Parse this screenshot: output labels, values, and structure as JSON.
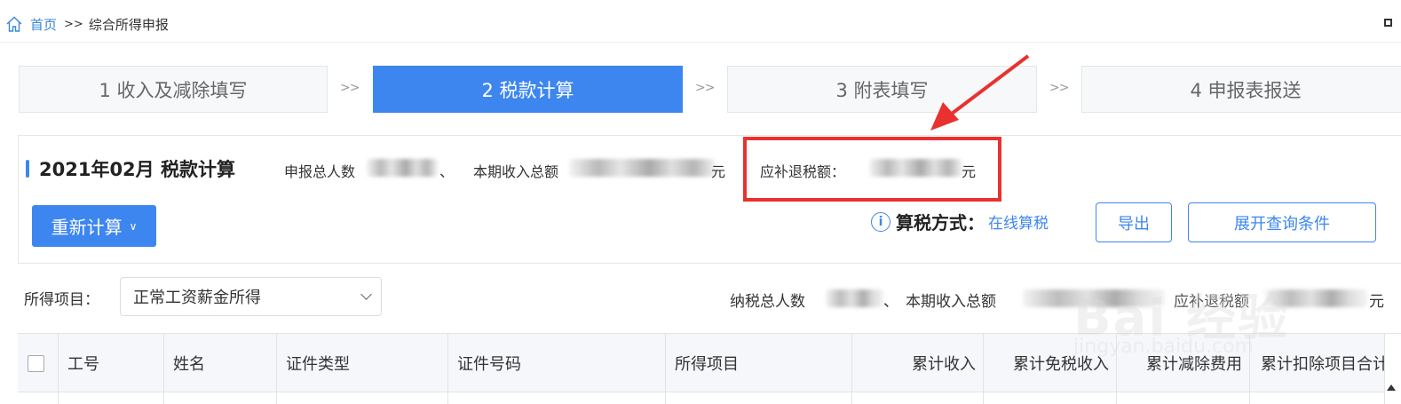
{
  "breadcrumb": {
    "home_icon": "home-icon",
    "home": "首页",
    "separator": ">>",
    "current": "综合所得申报"
  },
  "steps": [
    {
      "label": "1 收入及减除填写",
      "active": false
    },
    {
      "label": "2 税款计算",
      "active": true
    },
    {
      "label": "3 附表填写",
      "active": false
    },
    {
      "label": "4 申报表报送",
      "active": false
    }
  ],
  "step_arrow": ">>",
  "calc": {
    "title": "2021年02月  税款计算",
    "total_people_label": "申报总人数",
    "separator": "、",
    "income_label": "本期收入总额",
    "unit": "元",
    "refund_label": "应补退税额：",
    "recalc_label": "重新计算",
    "method_label": "算税方式：",
    "method_value": "在线算税",
    "export_label": "导出",
    "expand_label": "展开查询条件"
  },
  "filter": {
    "label": "所得项目：",
    "selected": "正常工资薪金所得"
  },
  "summary": {
    "taxpayers_label": "纳税总人数",
    "separator": "、",
    "income_label": "本期收入总额",
    "refund_label": "应补退税额",
    "unit": "元"
  },
  "table": {
    "columns": [
      "工号",
      "姓名",
      "证件类型",
      "证件号码",
      "所得项目",
      "累计收入",
      "累计免税收入",
      "累计减除费用",
      "累计扣除项目合计"
    ]
  },
  "watermark": {
    "text": "Bai 经验",
    "url": "jingyan.baidu.com"
  },
  "colors": {
    "primary": "#3d86f0",
    "highlight": "#e8322f"
  }
}
